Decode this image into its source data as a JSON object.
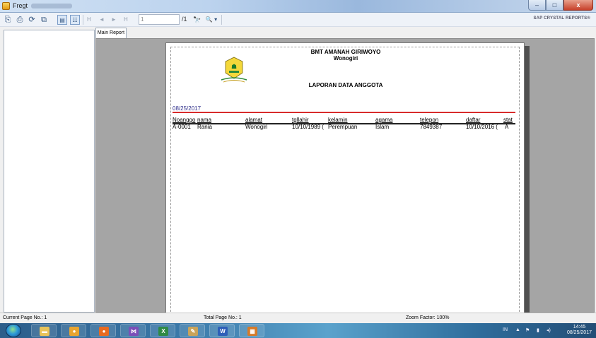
{
  "window": {
    "title": "Fregt",
    "buttons": {
      "minimize": "–",
      "maximize": "□",
      "close": "x"
    }
  },
  "toolbar": {
    "icons": [
      "export-icon",
      "print-icon",
      "refresh-icon",
      "copy-icon",
      "toggle-group-tree-icon",
      "group-tree-icon"
    ],
    "nav": {
      "first": "H",
      "prev": "◄",
      "next": "►",
      "last": "H"
    },
    "page_input": "1",
    "page_total": "/1",
    "search_glyph": "🔭",
    "zoom_glyph": "🔍 ▾",
    "brand": "SAP CRYSTAL REPORTS®"
  },
  "tabs": [
    {
      "label": "Main Report"
    }
  ],
  "report": {
    "org_name": "BMT AMANAH GIRIWOYO",
    "org_city": "Wonogiri",
    "title": "LAPORAN DATA ANGGOTA",
    "date": "08/25/2017",
    "columns": [
      "Noanggo",
      "nama",
      "alamat",
      "tgllahir",
      "kelamin",
      "agama",
      "telepon",
      "daftar",
      "stat"
    ],
    "rows": [
      [
        "A-0001",
        "Rania",
        "Wonogiri",
        "10/10/1989  (",
        "Perempuan",
        "Islam",
        "7849387",
        "10/10/2016  (",
        "A"
      ]
    ]
  },
  "status": {
    "current_page": "Current Page No.: 1",
    "total_page": "Total Page No.: 1",
    "zoom": "Zoom Factor: 100%"
  },
  "taskbar": {
    "apps": [
      {
        "name": "explorer",
        "glyph": "▬",
        "color": "#e8c35a"
      },
      {
        "name": "chrome",
        "glyph": "●",
        "color": "#e8a430"
      },
      {
        "name": "firefox",
        "glyph": "●",
        "color": "#e86a20"
      },
      {
        "name": "visual-studio",
        "glyph": "⋈",
        "color": "#7b4fb8"
      },
      {
        "name": "excel",
        "glyph": "X",
        "color": "#2f8a46"
      },
      {
        "name": "paint",
        "glyph": "✎",
        "color": "#c9a35a"
      },
      {
        "name": "word",
        "glyph": "W",
        "color": "#2d5fb8"
      },
      {
        "name": "report-app",
        "glyph": "▦",
        "color": "#d47a2a"
      }
    ],
    "tray": {
      "language": "IN",
      "chevron": "▲",
      "time": "14:45",
      "date": "08/25/2017"
    }
  }
}
